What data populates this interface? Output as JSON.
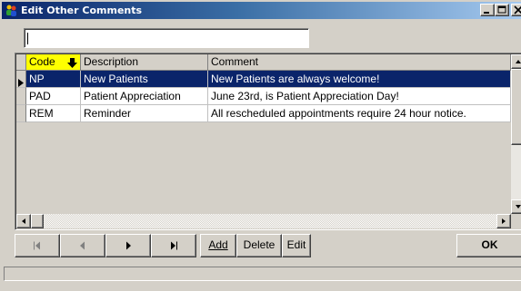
{
  "window": {
    "title": "Edit Other Comments"
  },
  "search": {
    "value": ""
  },
  "grid": {
    "columns": [
      "Code",
      "Description",
      "Comment"
    ],
    "sorted_column": "Code",
    "rows": [
      {
        "code": "NP",
        "description": "New Patients",
        "comment": "New Patients are always welcome!",
        "selected": true
      },
      {
        "code": "PAD",
        "description": "Patient Appreciation",
        "comment": "June 23rd, is Patient Appreciation Day!",
        "selected": false
      },
      {
        "code": "REM",
        "description": "Reminder",
        "comment": "All rescheduled appointments require 24 hour notice.",
        "selected": false
      }
    ]
  },
  "toolbar": {
    "add_label": "Add",
    "delete_label": "Delete",
    "edit_label": "Edit",
    "ok_label": "OK"
  },
  "colors": {
    "title_gradient_start": "#0a246a",
    "selection": "#0a246a",
    "sorted_header": "#ffff00",
    "face": "#d4d0c8"
  },
  "icons": {
    "app": "people-icon",
    "sort": "arrow-down-icon",
    "row_pointer": "triangle-right-icon",
    "nav_first": "first-record-icon",
    "nav_prev": "prev-record-icon",
    "nav_next": "next-record-icon",
    "nav_last": "last-record-icon"
  }
}
